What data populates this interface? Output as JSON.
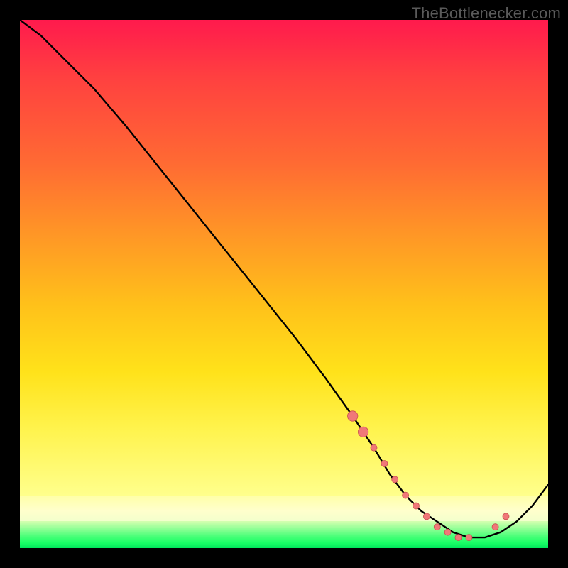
{
  "watermark": "TheBottlenecker.com",
  "colors": {
    "frame_bg": "#000000",
    "curve_stroke": "#000000",
    "marker_fill": "#f07878",
    "marker_stroke": "#c95050"
  },
  "chart_data": {
    "type": "line",
    "title": "",
    "xlabel": "",
    "ylabel": "",
    "xlim": [
      0,
      100
    ],
    "ylim": [
      0,
      100
    ],
    "series": [
      {
        "name": "curve",
        "x": [
          0,
          4,
          8,
          14,
          20,
          28,
          36,
          44,
          52,
          58,
          63,
          67,
          70,
          73,
          76,
          79,
          82,
          85,
          88,
          91,
          94,
          97,
          100
        ],
        "y": [
          100,
          97,
          93,
          87,
          80,
          70,
          60,
          50,
          40,
          32,
          25,
          19,
          14,
          10,
          7,
          5,
          3,
          2,
          2,
          3,
          5,
          8,
          12
        ]
      }
    ],
    "markers": {
      "name": "highlight-points",
      "x": [
        63,
        65,
        67,
        69,
        71,
        73,
        75,
        77,
        79,
        81,
        83,
        85,
        90,
        92
      ],
      "y": [
        25,
        22,
        19,
        16,
        13,
        10,
        8,
        6,
        4,
        3,
        2,
        2,
        4,
        6
      ],
      "size_default": 4.5,
      "size_large_indices": [
        0,
        1
      ]
    },
    "background_bands": [
      {
        "from_y": 10,
        "to_y": 100,
        "gradient": "red-to-yellow"
      },
      {
        "from_y": 5,
        "to_y": 10,
        "gradient": "pale-yellow"
      },
      {
        "from_y": 0,
        "to_y": 5,
        "gradient": "green"
      }
    ]
  }
}
